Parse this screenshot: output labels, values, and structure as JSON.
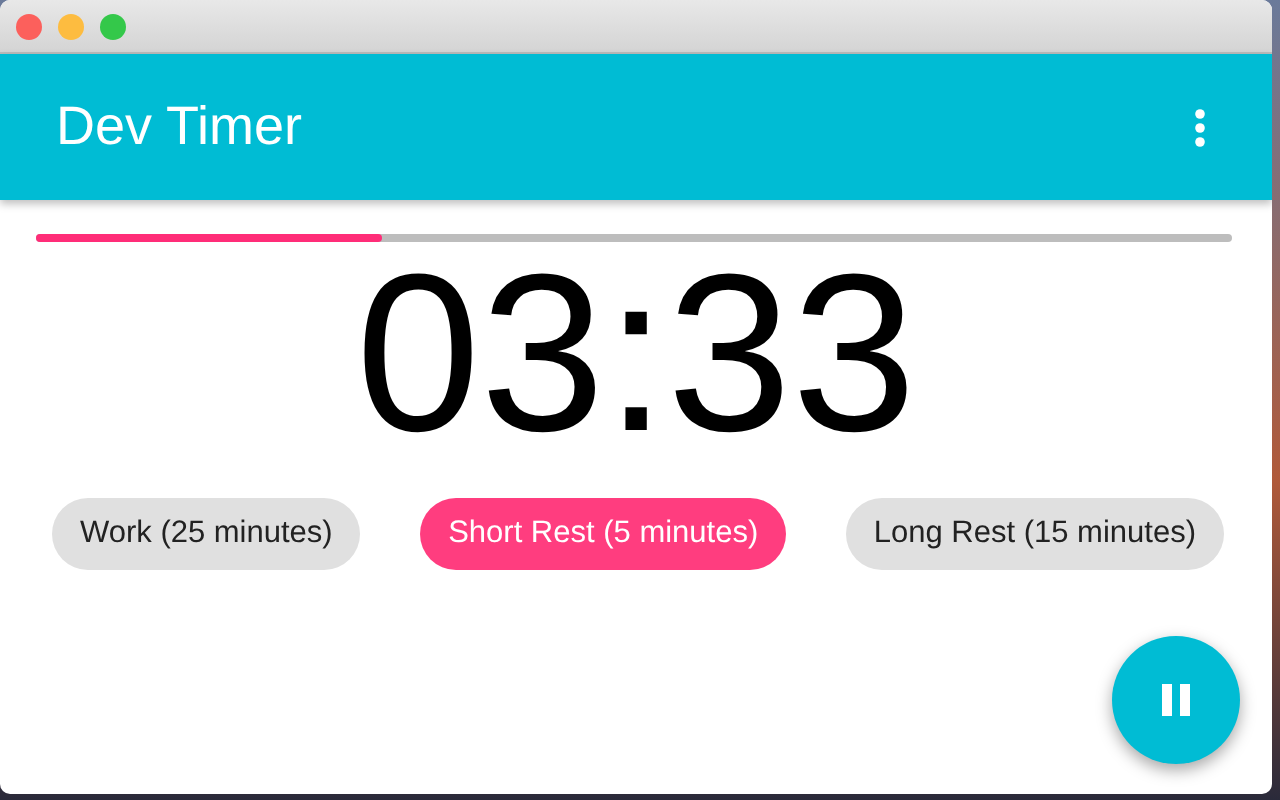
{
  "app_bar": {
    "title": "Dev Timer"
  },
  "progress": {
    "level": 0.29
  },
  "timer": {
    "time": "03:33"
  },
  "modes": [
    {
      "label": "Work (25 minutes)",
      "selected": false
    },
    {
      "label": "Short Rest (5 minutes)",
      "selected": true
    },
    {
      "label": "Long Rest (15 minutes)",
      "selected": false
    }
  ],
  "fab": {
    "running": true
  }
}
